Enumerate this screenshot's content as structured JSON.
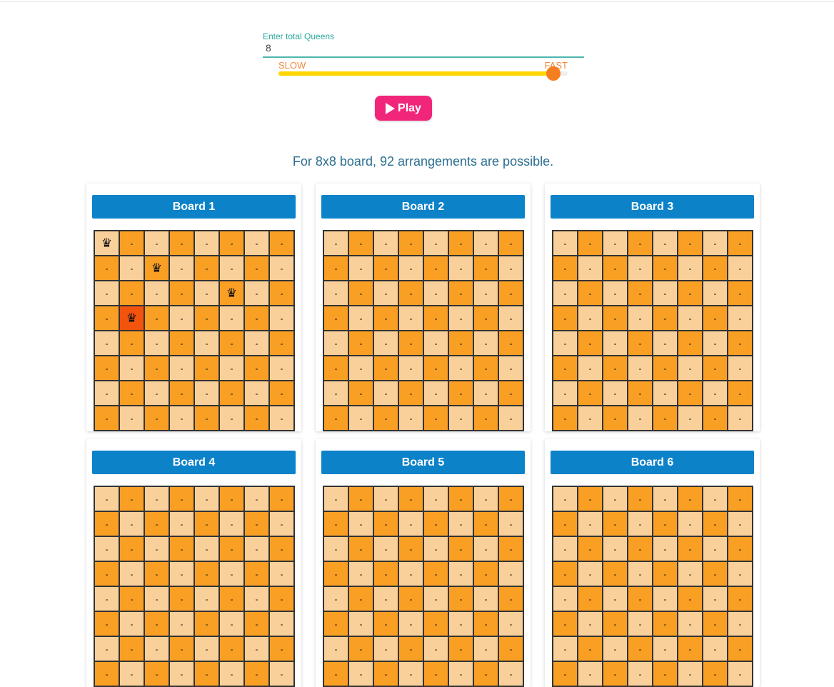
{
  "form": {
    "queens_label": "Enter total Queens",
    "queens_value": "8"
  },
  "speed": {
    "slow_label": "SLOW",
    "fast_label": "FAST",
    "level": 0.95
  },
  "play_button": {
    "label": "Play"
  },
  "info_text": "For 8x8 board, 92 arrangements are possible.",
  "colors": {
    "light_square": "#fad09a",
    "dark_square": "#f99f24",
    "highlight_square": "#f2530d",
    "header": "#0c82c9",
    "play": "#f1267a",
    "slider_fill": "#ffd600",
    "slider_thumb": "#f57f20"
  },
  "empty_marker": "-",
  "queen_icon": "queen-icon",
  "boards": [
    {
      "title": "Board 1",
      "queens": [
        {
          "row": 0,
          "col": 0
        },
        {
          "row": 1,
          "col": 2
        },
        {
          "row": 2,
          "col": 5
        },
        {
          "row": 3,
          "col": 1
        }
      ],
      "highlight": [
        {
          "row": 3,
          "col": 1
        }
      ]
    },
    {
      "title": "Board 2",
      "queens": [],
      "highlight": []
    },
    {
      "title": "Board 3",
      "queens": [],
      "highlight": []
    },
    {
      "title": "Board 4",
      "queens": [],
      "highlight": []
    },
    {
      "title": "Board 5",
      "queens": [],
      "highlight": []
    },
    {
      "title": "Board 6",
      "queens": [],
      "highlight": []
    }
  ]
}
